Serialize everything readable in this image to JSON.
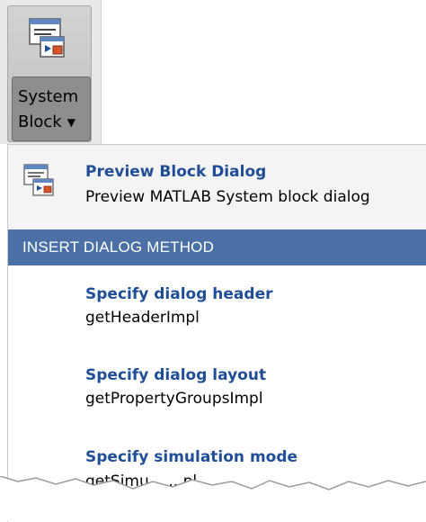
{
  "toolbar": {
    "system_block_button": {
      "icon": "preview-dialog-icon",
      "label_line1": "System",
      "label_line2": "Block",
      "dropdown": "chevron-down-icon"
    }
  },
  "menu": {
    "preview": {
      "icon": "preview-dialog-icon",
      "title": "Preview Block Dialog",
      "subtitle": "Preview MATLAB System block dialog"
    },
    "section_header": "INSERT DIALOG METHOD",
    "methods": [
      {
        "title": "Specify dialog header",
        "subtitle": "getHeaderImpl"
      },
      {
        "title": "Specify dialog layout",
        "subtitle": "getPropertyGroupsImpl"
      },
      {
        "title": "Specify simulation mode",
        "subtitle": "getSimu... ...pl"
      }
    ]
  },
  "colors": {
    "title_blue": "#1f4e96",
    "section_header_bg": "#4a70a6",
    "menu_bg": "#f4f4f4",
    "toolbar_bg": "#e9e9e9"
  }
}
